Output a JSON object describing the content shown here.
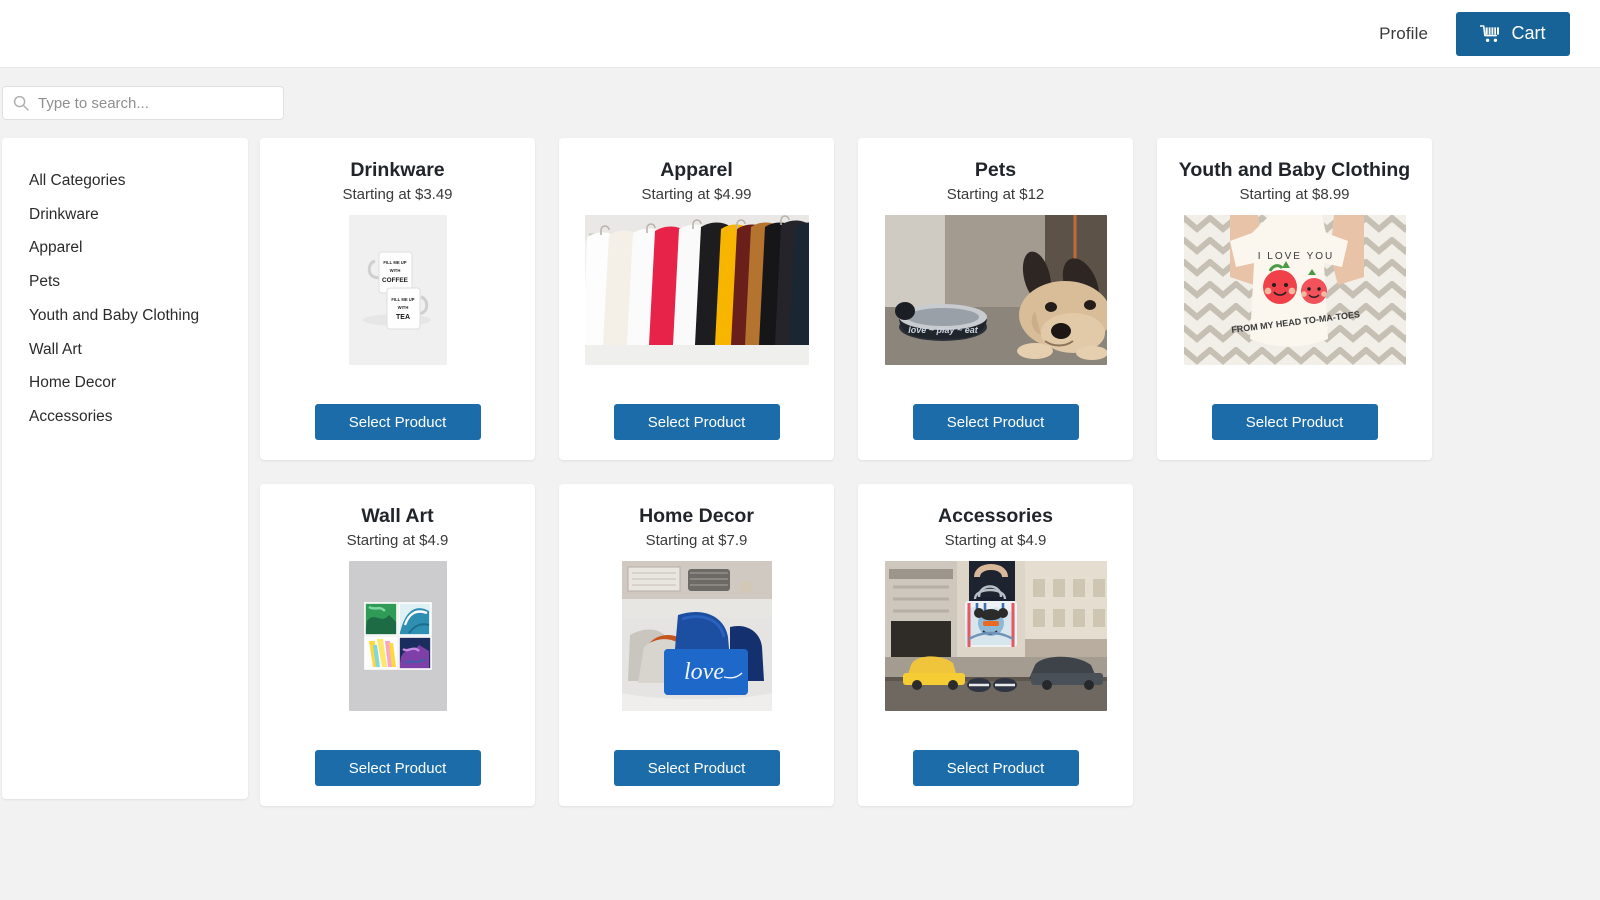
{
  "header": {
    "profile_label": "Profile",
    "cart_label": "Cart",
    "cart_icon": "shopping-cart-icon",
    "cart_color": "#176397"
  },
  "search": {
    "placeholder": "Type to search...",
    "value": "",
    "icon": "search-icon"
  },
  "sidebar": {
    "items": [
      {
        "label": "All Categories"
      },
      {
        "label": "Drinkware"
      },
      {
        "label": "Apparel"
      },
      {
        "label": "Pets"
      },
      {
        "label": "Youth and Baby Clothing"
      },
      {
        "label": "Wall Art"
      },
      {
        "label": "Home Decor"
      },
      {
        "label": "Accessories"
      }
    ]
  },
  "products": {
    "button_label": "Select Product",
    "button_color": "#1b6ca8",
    "items": [
      {
        "title": "Drinkware",
        "price": "Starting at $3.49",
        "image": "stacked-white-mugs-coffee-tea",
        "image_text": [
          "FILL ME UP WITH COFFEE",
          "FILL ME UP WITH TEA"
        ]
      },
      {
        "title": "Apparel",
        "price": "Starting at $4.99",
        "image": "clothing-rack-shirts"
      },
      {
        "title": "Pets",
        "price": "Starting at $12",
        "image": "french-bulldog-with-bowl",
        "image_text": [
          "love - play - eat"
        ]
      },
      {
        "title": "Youth and Baby Clothing",
        "price": "Starting at $8.99",
        "image": "baby-onesie-tomatoes",
        "image_text": [
          "I LOVE YOU",
          "FROM MY HEAD TO-MA-TOES"
        ]
      },
      {
        "title": "Wall Art",
        "price": "Starting at $4.9",
        "image": "four-abstract-canvases-on-wall"
      },
      {
        "title": "Home Decor",
        "price": "Starting at $7.9",
        "image": "blue-throw-pillows-love",
        "image_text": [
          "love"
        ]
      },
      {
        "title": "Accessories",
        "price": "Starting at $4.9",
        "image": "printed-tote-bag-city-street"
      }
    ]
  }
}
